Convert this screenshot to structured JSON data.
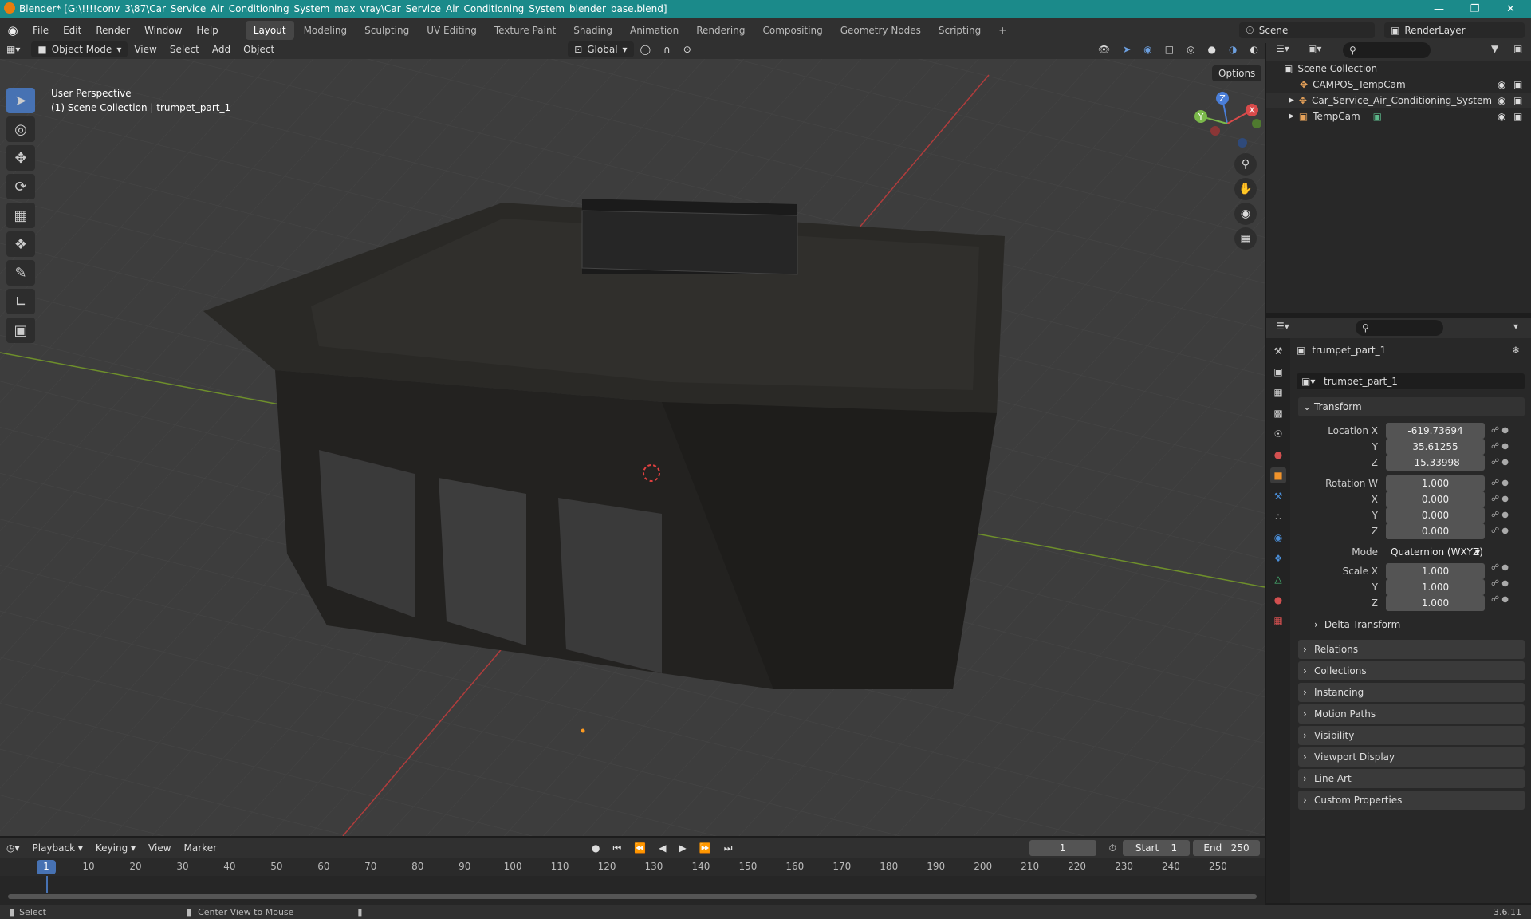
{
  "window": {
    "title": "Blender* [G:\\!!!!conv_3\\87\\Car_Service_Air_Conditioning_System_max_vray\\Car_Service_Air_Conditioning_System_blender_base.blend]"
  },
  "menu": [
    "File",
    "Edit",
    "Render",
    "Window",
    "Help"
  ],
  "workspaces": [
    "Layout",
    "Modeling",
    "Sculpting",
    "UV Editing",
    "Texture Paint",
    "Shading",
    "Animation",
    "Rendering",
    "Compositing",
    "Geometry Nodes",
    "Scripting"
  ],
  "scene": {
    "name": "Scene",
    "view_layer": "RenderLayer"
  },
  "viewport_header": {
    "mode": "Object Mode",
    "view": "View",
    "select": "Select",
    "add": "Add",
    "object": "Object",
    "orientation": "Global",
    "options": "Options"
  },
  "viewport_overlay": {
    "line1": "User Perspective",
    "line2": "(1) Scene Collection | trumpet_part_1"
  },
  "gizmo": {
    "x": "X",
    "y": "Y",
    "z": "Z"
  },
  "outliner": {
    "root": "Scene Collection",
    "items": [
      {
        "name": "CAMPOS_TempCam"
      },
      {
        "name": "Car_Service_Air_Conditioning_System"
      },
      {
        "name": "TempCam"
      }
    ]
  },
  "properties": {
    "object_name": "trumpet_part_1",
    "data_name": "trumpet_part_1",
    "transform_label": "Transform",
    "location": {
      "label": "Location X",
      "x": "-619.73694",
      "y": "35.61255",
      "z": "-15.33998"
    },
    "rotation": {
      "label": "Rotation W",
      "w": "1.000",
      "x": "0.000",
      "y": "0.000",
      "z": "0.000"
    },
    "mode_label": "Mode",
    "mode_value": "Quaternion (WXYZ)",
    "scale": {
      "label": "Scale X",
      "x": "1.000",
      "y": "1.000",
      "z": "1.000"
    },
    "axis_y": "Y",
    "axis_z": "Z",
    "axis_x": "X",
    "delta": "Delta Transform",
    "panels": [
      "Relations",
      "Collections",
      "Instancing",
      "Motion Paths",
      "Visibility",
      "Viewport Display",
      "Line Art",
      "Custom Properties"
    ]
  },
  "timeline": {
    "playback": "Playback",
    "keying": "Keying",
    "view": "View",
    "marker": "Marker",
    "current_frame": "1",
    "start_label": "Start",
    "start": "1",
    "end_label": "End",
    "end": "250",
    "ticks": [
      "1",
      "10",
      "20",
      "30",
      "40",
      "50",
      "60",
      "70",
      "80",
      "90",
      "100",
      "110",
      "120",
      "130",
      "140",
      "150",
      "160",
      "170",
      "180",
      "190",
      "200",
      "210",
      "220",
      "230",
      "240",
      "250"
    ]
  },
  "status": {
    "select": "Select",
    "center": "Center View to Mouse",
    "version": "3.6.11"
  }
}
